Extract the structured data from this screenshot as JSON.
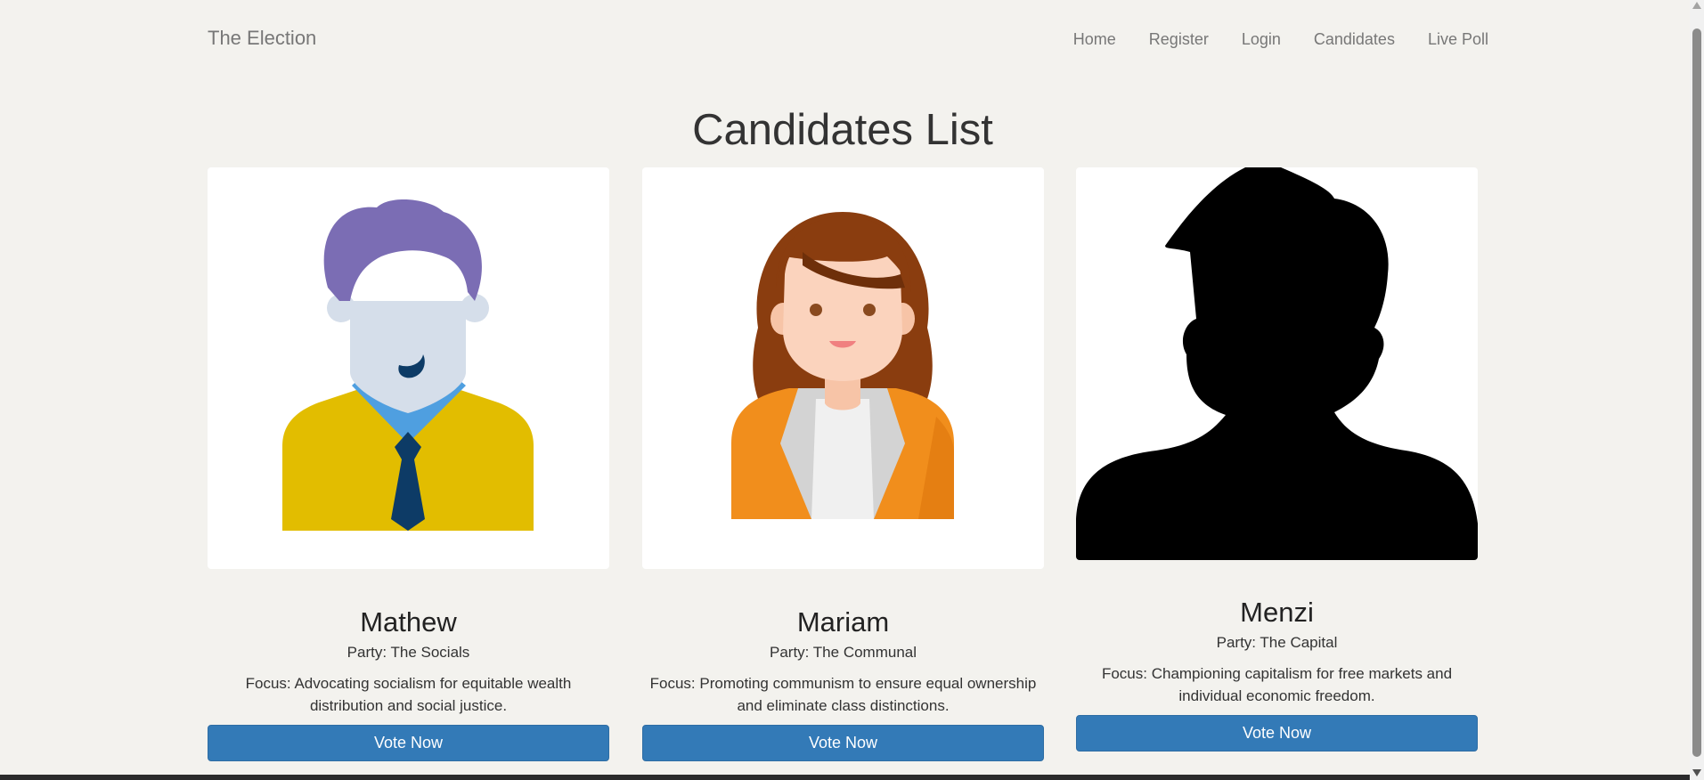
{
  "navbar": {
    "brand": "The Election",
    "links": [
      "Home",
      "Register",
      "Login",
      "Candidates",
      "Live Poll"
    ]
  },
  "page": {
    "title": "Candidates List"
  },
  "candidates": [
    {
      "name": "Mathew",
      "party": "Party: The Socials",
      "focus": "Focus: Advocating socialism for equitable wealth distribution and social justice.",
      "button": "Vote Now",
      "avatar_icon": "man-avatar-icon"
    },
    {
      "name": "Mariam",
      "party": "Party: The Communal",
      "focus": "Focus: Promoting communism to ensure equal ownership and eliminate class distinctions.",
      "button": "Vote Now",
      "avatar_icon": "woman-avatar-icon"
    },
    {
      "name": "Menzi",
      "party": "Party: The Capital",
      "focus": "Focus: Championing capitalism for free markets and individual economic freedom.",
      "button": "Vote Now",
      "avatar_icon": "silhouette-avatar-icon"
    }
  ],
  "colors": {
    "background": "#f3f2ee",
    "button": "#337ab7",
    "nav_text": "#777777"
  }
}
